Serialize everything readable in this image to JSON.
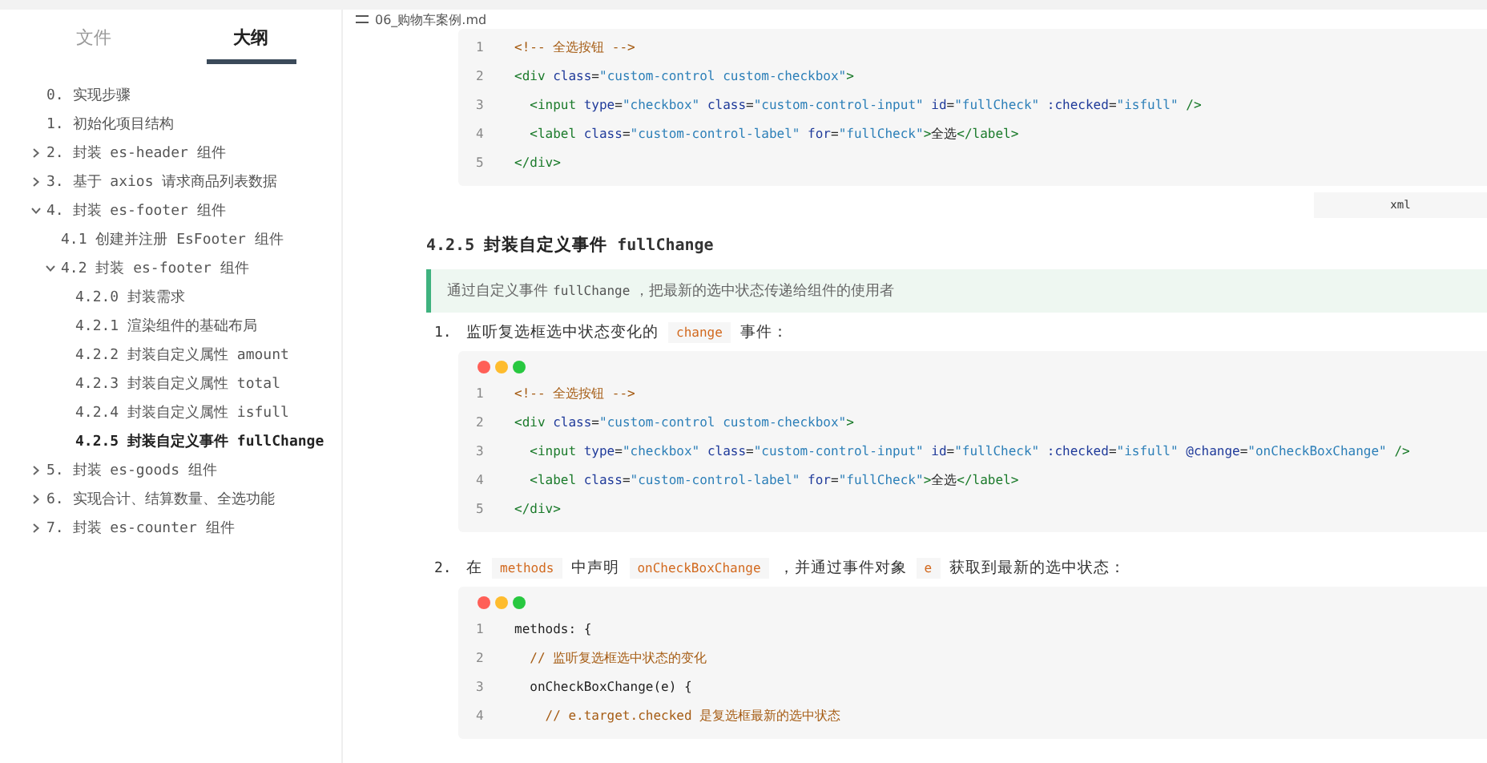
{
  "sidebar": {
    "tabs": [
      {
        "label": "文件",
        "selected": false
      },
      {
        "label": "大纲",
        "selected": true
      }
    ],
    "outline": [
      {
        "label": "0. 实现步骤",
        "selected": false
      },
      {
        "label": "1. 初始化项目结构",
        "selected": false
      },
      {
        "label": "2. 封装 es-header 组件",
        "expanded": false,
        "selected": false
      },
      {
        "label": "3. 基于 axios 请求商品列表数据",
        "expanded": false,
        "selected": false
      },
      {
        "label": "4. 封装 es-footer 组件",
        "expanded": true,
        "selected": false,
        "children": [
          {
            "label": "4.1 创建并注册 EsFooter 组件",
            "selected": false
          },
          {
            "label": "4.2 封装 es-footer 组件",
            "expanded": true,
            "selected": false,
            "children": [
              {
                "label": "4.2.0 封装需求",
                "selected": false
              },
              {
                "label": "4.2.1 渲染组件的基础布局",
                "selected": false
              },
              {
                "label": "4.2.2 封装自定义属性 amount",
                "selected": false
              },
              {
                "label": "4.2.3 封装自定义属性 total",
                "selected": false
              },
              {
                "label": "4.2.4 封装自定义属性 isfull",
                "selected": false
              },
              {
                "label": "4.2.5 封装自定义事件 fullChange",
                "selected": true
              }
            ]
          }
        ]
      },
      {
        "label": "5. 封装 es-goods 组件",
        "expanded": false,
        "selected": false
      },
      {
        "label": "6. 实现合计、结算数量、全选功能",
        "expanded": false,
        "selected": false
      },
      {
        "label": "7. 封装 es-counter 组件",
        "expanded": false,
        "selected": false
      }
    ]
  },
  "document": {
    "title": "06_购物车案例.md",
    "blocks": [
      {
        "kind": "code",
        "window_dots": false,
        "language": "xml",
        "lines": [
          {
            "number": "1",
            "tokens": [
              {
                "kind": "comment",
                "text": "<!-- 全选按钮 -->"
              }
            ]
          },
          {
            "number": "2",
            "tokens": [
              {
                "kind": "tag",
                "text": "<div"
              },
              {
                "kind": "attr",
                "text": " class"
              },
              {
                "kind": "plain",
                "text": "="
              },
              {
                "kind": "string",
                "text": "\"custom-control custom-checkbox\""
              },
              {
                "kind": "tag",
                "text": ">"
              }
            ]
          },
          {
            "number": "3",
            "tokens": [
              {
                "kind": "tag",
                "text": "  <input"
              },
              {
                "kind": "attr",
                "text": " type"
              },
              {
                "kind": "plain",
                "text": "="
              },
              {
                "kind": "string",
                "text": "\"checkbox\""
              },
              {
                "kind": "attr",
                "text": " class"
              },
              {
                "kind": "plain",
                "text": "="
              },
              {
                "kind": "string",
                "text": "\"custom-control-input\""
              },
              {
                "kind": "attr",
                "text": " id"
              },
              {
                "kind": "plain",
                "text": "="
              },
              {
                "kind": "string",
                "text": "\"fullCheck\""
              },
              {
                "kind": "attr",
                "text": " :checked"
              },
              {
                "kind": "plain",
                "text": "="
              },
              {
                "kind": "string",
                "text": "\"isfull\""
              },
              {
                "kind": "tag",
                "text": " />"
              }
            ]
          },
          {
            "number": "4",
            "tokens": [
              {
                "kind": "tag",
                "text": "  <label"
              },
              {
                "kind": "attr",
                "text": " class"
              },
              {
                "kind": "plain",
                "text": "="
              },
              {
                "kind": "string",
                "text": "\"custom-control-label\""
              },
              {
                "kind": "attr",
                "text": " for"
              },
              {
                "kind": "plain",
                "text": "="
              },
              {
                "kind": "string",
                "text": "\"fullCheck\""
              },
              {
                "kind": "tag",
                "text": ">"
              },
              {
                "kind": "plain",
                "text": "全选"
              },
              {
                "kind": "tag",
                "text": "</label>"
              }
            ]
          },
          {
            "number": "5",
            "tokens": [
              {
                "kind": "tag",
                "text": "</div>"
              }
            ]
          }
        ]
      },
      {
        "kind": "heading",
        "number": "4.2.5",
        "title": "封装自定义事件",
        "code": "fullChange"
      },
      {
        "kind": "quote",
        "segments": [
          {
            "kind": "text",
            "text": "通过自定义事件"
          },
          {
            "kind": "code",
            "text": "fullChange"
          },
          {
            "kind": "text",
            "text": "，把最新的选中状态传递给组件的使用者"
          }
        ]
      },
      {
        "kind": "list_item",
        "number": "1.",
        "segments": [
          {
            "kind": "text",
            "text": "监听复选框选中状态变化的"
          },
          {
            "kind": "code",
            "text": "change"
          },
          {
            "kind": "text",
            "text": "事件："
          }
        ]
      },
      {
        "kind": "code",
        "window_dots": true,
        "lines": [
          {
            "number": "1",
            "tokens": [
              {
                "kind": "comment",
                "text": "<!-- 全选按钮 -->"
              }
            ]
          },
          {
            "number": "2",
            "tokens": [
              {
                "kind": "tag",
                "text": "<div"
              },
              {
                "kind": "attr",
                "text": " class"
              },
              {
                "kind": "plain",
                "text": "="
              },
              {
                "kind": "string",
                "text": "\"custom-control custom-checkbox\""
              },
              {
                "kind": "tag",
                "text": ">"
              }
            ]
          },
          {
            "number": "3",
            "tokens": [
              {
                "kind": "tag",
                "text": "  <input"
              },
              {
                "kind": "attr",
                "text": " type"
              },
              {
                "kind": "plain",
                "text": "="
              },
              {
                "kind": "string",
                "text": "\"checkbox\""
              },
              {
                "kind": "attr",
                "text": " class"
              },
              {
                "kind": "plain",
                "text": "="
              },
              {
                "kind": "string",
                "text": "\"custom-control-input\""
              },
              {
                "kind": "attr",
                "text": " id"
              },
              {
                "kind": "plain",
                "text": "="
              },
              {
                "kind": "string",
                "text": "\"fullCheck\""
              },
              {
                "kind": "attr",
                "text": " :checked"
              },
              {
                "kind": "plain",
                "text": "="
              },
              {
                "kind": "string",
                "text": "\"isfull\""
              },
              {
                "kind": "attr",
                "text": " @change"
              },
              {
                "kind": "plain",
                "text": "="
              },
              {
                "kind": "string",
                "text": "\"onCheckBoxChange\""
              },
              {
                "kind": "tag",
                "text": " />"
              }
            ]
          },
          {
            "number": "4",
            "tokens": [
              {
                "kind": "tag",
                "text": "  <label"
              },
              {
                "kind": "attr",
                "text": " class"
              },
              {
                "kind": "plain",
                "text": "="
              },
              {
                "kind": "string",
                "text": "\"custom-control-label\""
              },
              {
                "kind": "attr",
                "text": " for"
              },
              {
                "kind": "plain",
                "text": "="
              },
              {
                "kind": "string",
                "text": "\"fullCheck\""
              },
              {
                "kind": "tag",
                "text": ">"
              },
              {
                "kind": "plain",
                "text": "全选"
              },
              {
                "kind": "tag",
                "text": "</label>"
              }
            ]
          },
          {
            "number": "5",
            "tokens": [
              {
                "kind": "tag",
                "text": "</div>"
              }
            ]
          }
        ]
      },
      {
        "kind": "list_item",
        "number": "2.",
        "segments": [
          {
            "kind": "text",
            "text": "在"
          },
          {
            "kind": "code",
            "text": "methods"
          },
          {
            "kind": "text",
            "text": "中声明"
          },
          {
            "kind": "code",
            "text": "onCheckBoxChange"
          },
          {
            "kind": "text",
            "text": "，并通过事件对象"
          },
          {
            "kind": "code",
            "text": "e"
          },
          {
            "kind": "text",
            "text": "获取到最新的选中状态："
          }
        ]
      },
      {
        "kind": "code",
        "window_dots": true,
        "lines": [
          {
            "number": "1",
            "tokens": [
              {
                "kind": "plain",
                "text": "methods: {"
              }
            ]
          },
          {
            "number": "2",
            "tokens": [
              {
                "kind": "comment",
                "text": "  // 监听复选框选中状态的变化"
              }
            ]
          },
          {
            "number": "3",
            "tokens": [
              {
                "kind": "plain",
                "text": "  onCheckBoxChange(e) {"
              }
            ]
          },
          {
            "number": "4",
            "tokens": [
              {
                "kind": "comment",
                "text": "    // e.target.checked 是复选框最新的选中状态"
              }
            ]
          }
        ]
      }
    ]
  }
}
